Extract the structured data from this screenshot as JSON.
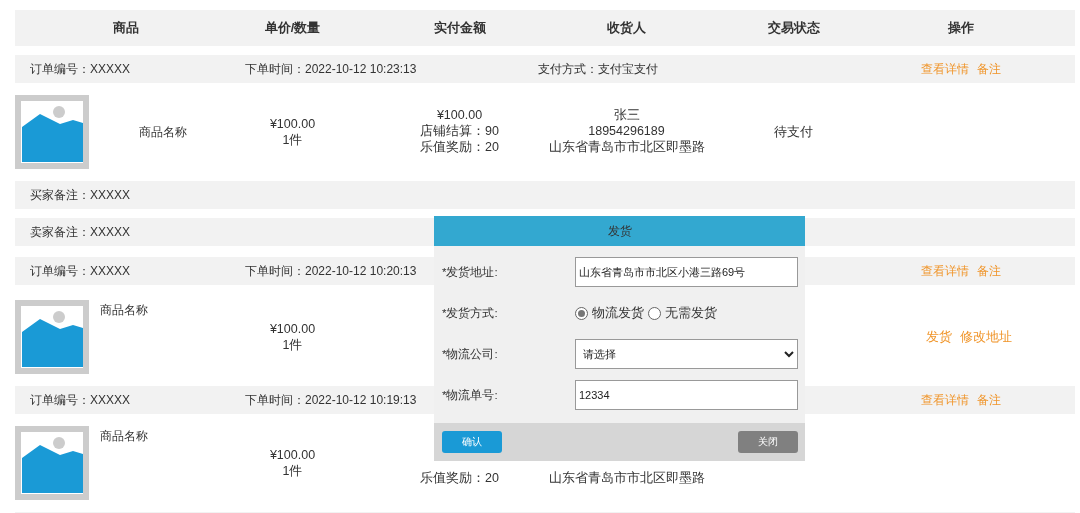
{
  "columns": [
    "商品",
    "单价/数量",
    "实付金额",
    "收货人",
    "交易状态",
    "操作"
  ],
  "orders": [
    {
      "order_no": "订单编号：XXXXX",
      "time": "下单时间：2022-10-12 10:23:13",
      "payment": "支付方式：支付宝支付",
      "links": [
        "查看详情",
        "备注"
      ],
      "product": {
        "name": "商品名称",
        "kind": "inline"
      },
      "price": "¥100.00",
      "quantity": "1件",
      "amount_lines": [
        "¥100.00",
        "店铺结算：90",
        "乐值奖励：20"
      ],
      "receiver_lines": [
        "张三",
        "18954296189",
        "山东省青岛市市北区即墨路"
      ],
      "status": "待支付",
      "buyer_note": "买家备注：XXXXX",
      "seller_note": "卖家备注：XXXXX"
    },
    {
      "order_no": "订单编号：XXXXX",
      "time": "下单时间：2022-10-12 10:20:13",
      "links": [
        "查看详情",
        "备注"
      ],
      "product": {
        "name": "商品名称",
        "kind": "stacked"
      },
      "price": "¥100.00",
      "quantity": "1件",
      "row_actions": [
        "发货",
        "修改地址"
      ]
    },
    {
      "order_no": "订单编号：XXXXX",
      "time": "下单时间：2022-10-12 10:19:13",
      "links": [
        "查看详情",
        "备注"
      ],
      "product": {
        "name": "商品名称",
        "kind": "stacked"
      },
      "price": "¥100.00",
      "quantity": "1件",
      "amount_lines": [
        "乐值奖励：20"
      ],
      "receiver_lines": [
        "山东省青岛市市北区即墨路"
      ]
    }
  ],
  "dialog": {
    "title": "发货",
    "fields": [
      {
        "kind": "text",
        "label": "*发货地址:",
        "value": "山东省青岛市市北区小港三路69号"
      },
      {
        "kind": "radio",
        "label": "*发货方式:",
        "options": [
          {
            "label": "物流发货",
            "selected": true
          },
          {
            "label": "无需发货",
            "selected": false
          }
        ]
      },
      {
        "kind": "select",
        "label": "*物流公司:",
        "value": "请选择"
      },
      {
        "kind": "text",
        "label": "*物流单号:",
        "value": "12334"
      }
    ],
    "buttons": [
      {
        "label": "确认",
        "kind": "primary"
      },
      {
        "label": "关闭",
        "kind": "secondary"
      }
    ]
  }
}
